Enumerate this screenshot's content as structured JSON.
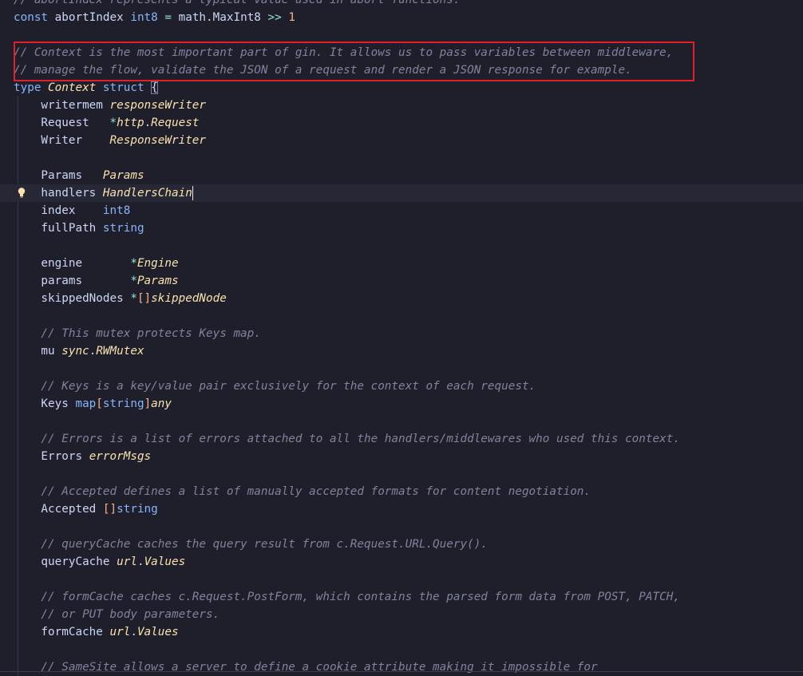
{
  "editor": {
    "language": "go",
    "lines": [
      {
        "tokens": [
          {
            "t": "// abortIndex represents a typical value used in abort functions.",
            "c": "cm"
          }
        ]
      },
      {
        "tokens": [
          {
            "t": "const",
            "c": "kw"
          },
          {
            "t": " abortIndex ",
            "c": "id"
          },
          {
            "t": "int8",
            "c": "bt"
          },
          {
            "t": " = ",
            "c": "op"
          },
          {
            "t": "math",
            "c": "id"
          },
          {
            "t": ".",
            "c": "dot"
          },
          {
            "t": "MaxInt8",
            "c": "id"
          },
          {
            "t": " >> ",
            "c": "op"
          },
          {
            "t": "1",
            "c": "num"
          }
        ]
      },
      {
        "tokens": []
      },
      {
        "tokens": [
          {
            "t": "// Context is the most important part of gin. It allows us to pass variables between middleware,",
            "c": "cm"
          }
        ]
      },
      {
        "tokens": [
          {
            "t": "// manage the flow, validate the JSON of a request and render a JSON response for example.",
            "c": "cm"
          }
        ]
      },
      {
        "tokens": [
          {
            "t": "type",
            "c": "kw"
          },
          {
            "t": " ",
            "c": "id"
          },
          {
            "t": "Context",
            "c": "ty"
          },
          {
            "t": " ",
            "c": "id"
          },
          {
            "t": "struct",
            "c": "kw"
          },
          {
            "t": " ",
            "c": "id"
          },
          {
            "t": "{",
            "c": "brace"
          }
        ]
      },
      {
        "tokens": [
          {
            "t": "    writermem ",
            "c": "id"
          },
          {
            "t": "responseWriter",
            "c": "ty"
          }
        ]
      },
      {
        "tokens": [
          {
            "t": "    Request   ",
            "c": "id"
          },
          {
            "t": "*",
            "c": "op"
          },
          {
            "t": "http",
            "c": "pk"
          },
          {
            "t": ".",
            "c": "dot"
          },
          {
            "t": "Request",
            "c": "ty"
          }
        ]
      },
      {
        "tokens": [
          {
            "t": "    Writer    ",
            "c": "id"
          },
          {
            "t": "ResponseWriter",
            "c": "ty"
          }
        ]
      },
      {
        "tokens": []
      },
      {
        "tokens": [
          {
            "t": "    Params   ",
            "c": "id"
          },
          {
            "t": "Params",
            "c": "ty"
          }
        ]
      },
      {
        "tokens": [
          {
            "t": "    handlers ",
            "c": "id"
          },
          {
            "t": "HandlersChain",
            "c": "ty"
          }
        ],
        "active": true,
        "bulb": true,
        "caret": true
      },
      {
        "tokens": [
          {
            "t": "    index    ",
            "c": "id"
          },
          {
            "t": "int8",
            "c": "bt"
          }
        ]
      },
      {
        "tokens": [
          {
            "t": "    fullPath ",
            "c": "id"
          },
          {
            "t": "string",
            "c": "bt"
          }
        ]
      },
      {
        "tokens": []
      },
      {
        "tokens": [
          {
            "t": "    engine       ",
            "c": "id"
          },
          {
            "t": "*",
            "c": "op"
          },
          {
            "t": "Engine",
            "c": "ty"
          }
        ]
      },
      {
        "tokens": [
          {
            "t": "    params       ",
            "c": "id"
          },
          {
            "t": "*",
            "c": "op"
          },
          {
            "t": "Params",
            "c": "ty"
          }
        ]
      },
      {
        "tokens": [
          {
            "t": "    skippedNodes ",
            "c": "id"
          },
          {
            "t": "*",
            "c": "op"
          },
          {
            "t": "[]",
            "c": "br"
          },
          {
            "t": "skippedNode",
            "c": "ty"
          }
        ]
      },
      {
        "tokens": []
      },
      {
        "tokens": [
          {
            "t": "    // This mutex protects Keys map.",
            "c": "cm"
          }
        ]
      },
      {
        "tokens": [
          {
            "t": "    mu ",
            "c": "id"
          },
          {
            "t": "sync",
            "c": "pk"
          },
          {
            "t": ".",
            "c": "dot"
          },
          {
            "t": "RWMutex",
            "c": "ty"
          }
        ]
      },
      {
        "tokens": []
      },
      {
        "tokens": [
          {
            "t": "    // Keys is a key/value pair exclusively for the context of each request.",
            "c": "cm"
          }
        ]
      },
      {
        "tokens": [
          {
            "t": "    Keys ",
            "c": "id"
          },
          {
            "t": "map",
            "c": "bt"
          },
          {
            "t": "[",
            "c": "br"
          },
          {
            "t": "string",
            "c": "bt"
          },
          {
            "t": "]",
            "c": "br"
          },
          {
            "t": "any",
            "c": "ty"
          }
        ]
      },
      {
        "tokens": []
      },
      {
        "tokens": [
          {
            "t": "    // Errors is a list of errors attached to all the handlers/middlewares who used this context.",
            "c": "cm"
          }
        ]
      },
      {
        "tokens": [
          {
            "t": "    Errors ",
            "c": "id"
          },
          {
            "t": "errorMsgs",
            "c": "ty"
          }
        ]
      },
      {
        "tokens": []
      },
      {
        "tokens": [
          {
            "t": "    // Accepted defines a list of manually accepted formats for content negotiation.",
            "c": "cm"
          }
        ]
      },
      {
        "tokens": [
          {
            "t": "    Accepted ",
            "c": "id"
          },
          {
            "t": "[]",
            "c": "br"
          },
          {
            "t": "string",
            "c": "bt"
          }
        ]
      },
      {
        "tokens": []
      },
      {
        "tokens": [
          {
            "t": "    // queryCache caches the query result from c.Request.URL.Query().",
            "c": "cm"
          }
        ]
      },
      {
        "tokens": [
          {
            "t": "    queryCache ",
            "c": "id"
          },
          {
            "t": "url",
            "c": "pk"
          },
          {
            "t": ".",
            "c": "dot"
          },
          {
            "t": "Values",
            "c": "ty"
          }
        ]
      },
      {
        "tokens": []
      },
      {
        "tokens": [
          {
            "t": "    // formCache caches c.Request.PostForm, which contains the parsed form data from POST, PATCH,",
            "c": "cm"
          }
        ]
      },
      {
        "tokens": [
          {
            "t": "    // or PUT body parameters.",
            "c": "cm"
          }
        ]
      },
      {
        "tokens": [
          {
            "t": "    formCache ",
            "c": "id"
          },
          {
            "t": "url",
            "c": "pk"
          },
          {
            "t": ".",
            "c": "dot"
          },
          {
            "t": "Values",
            "c": "ty"
          }
        ]
      },
      {
        "tokens": []
      },
      {
        "tokens": [
          {
            "t": "    // SameSite allows a server to define a cookie attribute making it impossible for",
            "c": "cm"
          }
        ]
      }
    ],
    "highlighted_region": {
      "label": "Context doc comment",
      "color": "#e0202a"
    },
    "colors": {
      "background": "#1e1f2b",
      "active_line": "#262836",
      "keyword": "#89b4fa",
      "type": "#f9e2af",
      "comment": "#7f849c",
      "number": "#fab387"
    },
    "icons": {
      "gutter_hint": "lightbulb-icon"
    }
  }
}
